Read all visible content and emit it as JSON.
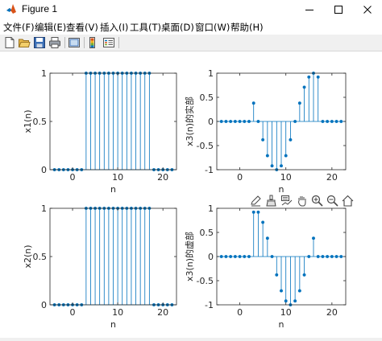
{
  "window": {
    "title": "Figure 1",
    "controls": [
      "minimize",
      "maximize",
      "close"
    ]
  },
  "menu": [
    {
      "label": "文件(F)"
    },
    {
      "label": "编辑(E)"
    },
    {
      "label": "查看(V)"
    },
    {
      "label": "插入(I)"
    },
    {
      "label": "工具(T)"
    },
    {
      "label": "桌面(D)"
    },
    {
      "label": "窗口(W)"
    },
    {
      "label": "帮助(H)"
    }
  ],
  "toolbar": {
    "icons": [
      "new-figure-icon",
      "open-file-icon",
      "save-icon",
      "print-icon",
      "link-plot-icon",
      "insert-colorbar-icon",
      "insert-legend-icon"
    ]
  },
  "axes_toolbar": {
    "icons": [
      "edit-icon",
      "brush-icon",
      "data-tips-icon",
      "pan-icon",
      "zoom-in-icon",
      "zoom-out-icon",
      "home-icon"
    ]
  },
  "colors": {
    "stem": "#0072bd",
    "axes": "#262626",
    "background": "#ffffff"
  },
  "chart_data": [
    {
      "type": "stem",
      "xlabel": "n",
      "ylabel": "x1(n)",
      "xlim": [
        -5,
        23
      ],
      "ylim": [
        0,
        1
      ],
      "xticks": [
        0,
        10,
        20
      ],
      "yticks": [
        0,
        0.5,
        1
      ],
      "ytick_labels": [
        "0",
        "0.5",
        "1"
      ],
      "x": [
        -4,
        -3,
        -2,
        -1,
        0,
        1,
        2,
        3,
        4,
        5,
        6,
        7,
        8,
        9,
        10,
        11,
        12,
        13,
        14,
        15,
        16,
        17,
        18,
        19,
        20,
        21,
        22
      ],
      "values": [
        0,
        0,
        0,
        0,
        0,
        0,
        0,
        1,
        1,
        1,
        1,
        1,
        1,
        1,
        1,
        1,
        1,
        1,
        1,
        1,
        1,
        1,
        0,
        0,
        0,
        0,
        0
      ]
    },
    {
      "type": "stem",
      "xlabel": "n",
      "ylabel": "x3(n)的实部",
      "xlim": [
        -5,
        23
      ],
      "ylim": [
        -1,
        1
      ],
      "xticks": [
        0,
        10,
        20
      ],
      "yticks": [
        -1,
        -0.5,
        0,
        0.5,
        1
      ],
      "ytick_labels": [
        "-1",
        "-0.5",
        "0",
        "0.5",
        "1"
      ],
      "x": [
        -4,
        -3,
        -2,
        -1,
        0,
        1,
        2,
        3,
        4,
        5,
        6,
        7,
        8,
        9,
        10,
        11,
        12,
        13,
        14,
        15,
        16,
        17,
        18,
        19,
        20,
        21,
        22
      ],
      "values": [
        0,
        0,
        0,
        0,
        0,
        0,
        0,
        0.38,
        0,
        -0.38,
        -0.71,
        -0.92,
        -1,
        -0.92,
        -0.71,
        -0.38,
        0,
        0.38,
        0.71,
        0.92,
        1,
        0.92,
        0,
        0,
        0,
        0,
        0
      ]
    },
    {
      "type": "stem",
      "xlabel": "n",
      "ylabel": "x2(n)",
      "xlim": [
        -5,
        23
      ],
      "ylim": [
        0,
        1
      ],
      "xticks": [
        0,
        10,
        20
      ],
      "yticks": [
        0,
        0.5,
        1
      ],
      "ytick_labels": [
        "0",
        "0.5",
        "1"
      ],
      "x": [
        -4,
        -3,
        -2,
        -1,
        0,
        1,
        2,
        3,
        4,
        5,
        6,
        7,
        8,
        9,
        10,
        11,
        12,
        13,
        14,
        15,
        16,
        17,
        18,
        19,
        20,
        21,
        22
      ],
      "values": [
        0,
        0,
        0,
        0,
        0,
        0,
        0,
        1,
        1,
        1,
        1,
        1,
        1,
        1,
        1,
        1,
        1,
        1,
        1,
        1,
        1,
        1,
        0,
        0,
        0,
        0,
        0
      ]
    },
    {
      "type": "stem",
      "xlabel": "n",
      "ylabel": "x3(n)的虚部",
      "xlim": [
        -5,
        23
      ],
      "ylim": [
        -1,
        1
      ],
      "xticks": [
        0,
        10,
        20
      ],
      "yticks": [
        -1,
        -0.5,
        0,
        0.5,
        1
      ],
      "ytick_labels": [
        "-1",
        "-0.5",
        "0",
        "0.5",
        "1"
      ],
      "x": [
        -4,
        -3,
        -2,
        -1,
        0,
        1,
        2,
        3,
        4,
        5,
        6,
        7,
        8,
        9,
        10,
        11,
        12,
        13,
        14,
        15,
        16,
        17,
        18,
        19,
        20,
        21,
        22
      ],
      "values": [
        0,
        0,
        0,
        0,
        0,
        0,
        0,
        0.92,
        0.92,
        0.71,
        0.38,
        0,
        -0.38,
        -0.71,
        -0.92,
        -1,
        -0.92,
        -0.71,
        -0.38,
        0,
        0.38,
        0,
        0,
        0,
        0,
        0,
        0
      ]
    }
  ]
}
